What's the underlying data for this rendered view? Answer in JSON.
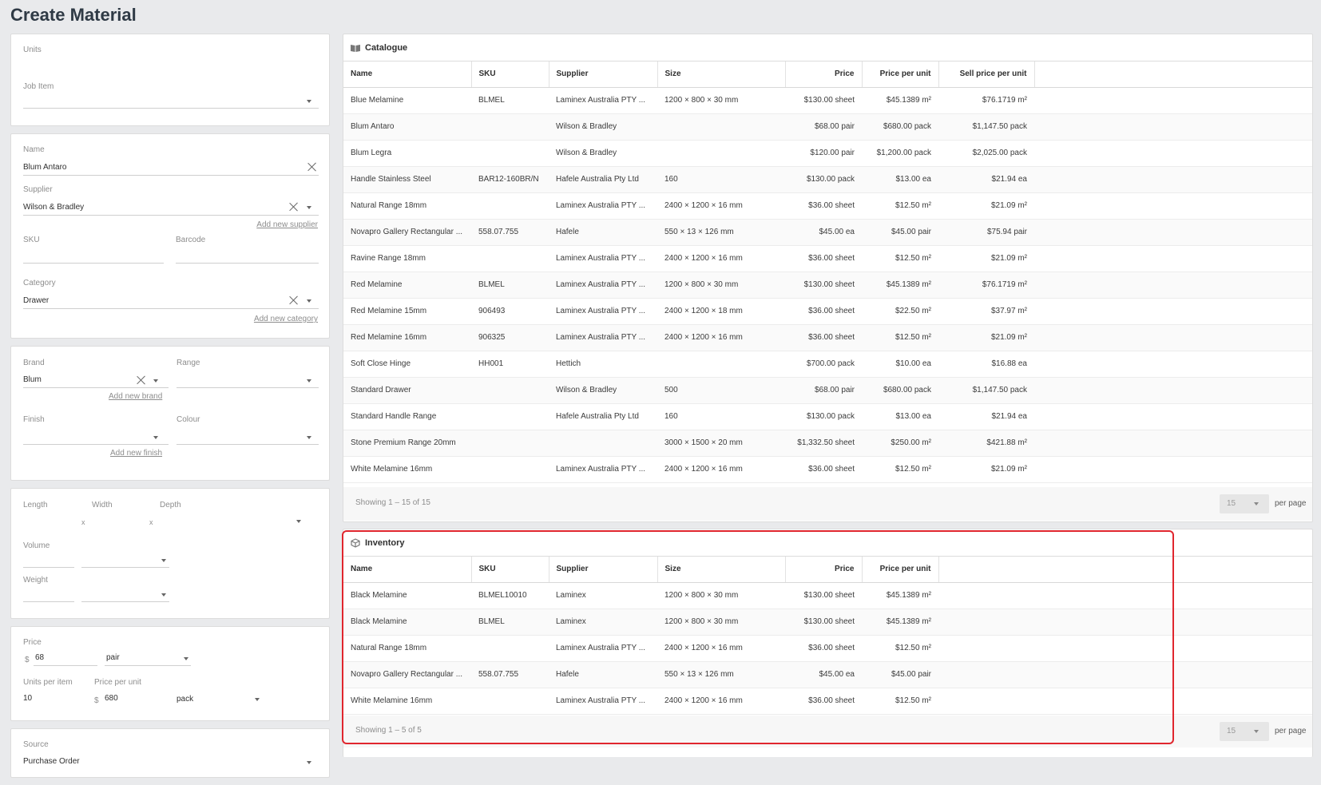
{
  "page": {
    "title": "Create Material"
  },
  "form": {
    "units_label": "Units",
    "job_item_label": "Job Item",
    "name_label": "Name",
    "name_value": "Blum Antaro",
    "supplier_label": "Supplier",
    "supplier_value": "Wilson & Bradley",
    "add_supplier": "Add new supplier",
    "sku_label": "SKU",
    "barcode_label": "Barcode",
    "category_label": "Category",
    "category_value": "Drawer",
    "add_category": "Add new category",
    "brand_label": "Brand",
    "brand_value": "Blum",
    "add_brand": "Add new brand",
    "range_label": "Range",
    "finish_label": "Finish",
    "add_finish": "Add new finish",
    "colour_label": "Colour",
    "length_label": "Length",
    "width_label": "Width",
    "depth_label": "Depth",
    "dim_sep": "x",
    "volume_label": "Volume",
    "weight_label": "Weight",
    "price_label": "Price",
    "currency": "$",
    "price_value": "68",
    "price_unit": "pair",
    "units_per_item_label": "Units per item",
    "units_per_item_value": "10",
    "price_per_unit_label": "Price per unit",
    "price_per_unit_value": "680",
    "price_per_unit_unit": "pack",
    "source_label": "Source",
    "source_value": "Purchase Order"
  },
  "catalogue": {
    "title": "Catalogue",
    "icon": "book-icon",
    "columns": [
      "Name",
      "SKU",
      "Supplier",
      "Size",
      "Price",
      "Price per unit",
      "Sell price per unit"
    ],
    "rows": [
      [
        "Blue Melamine",
        "BLMEL",
        "Laminex Australia PTY ...",
        "1200 × 800 × 30 mm",
        "$130.00 sheet",
        "$45.1389 m²",
        "$76.1719 m²"
      ],
      [
        "Blum Antaro",
        "",
        "Wilson & Bradley",
        "",
        "$68.00 pair",
        "$680.00 pack",
        "$1,147.50 pack"
      ],
      [
        "Blum Legra",
        "",
        "Wilson & Bradley",
        "",
        "$120.00 pair",
        "$1,200.00 pack",
        "$2,025.00 pack"
      ],
      [
        "Handle Stainless Steel",
        "BAR12-160BR/N",
        "Hafele Australia Pty Ltd",
        "160",
        "$130.00 pack",
        "$13.00 ea",
        "$21.94 ea"
      ],
      [
        "Natural Range 18mm",
        "",
        "Laminex Australia PTY ...",
        "2400 × 1200 × 16 mm",
        "$36.00 sheet",
        "$12.50 m²",
        "$21.09 m²"
      ],
      [
        "Novapro Gallery Rectangular ...",
        "558.07.755",
        "Hafele",
        "550 × 13 × 126 mm",
        "$45.00 ea",
        "$45.00 pair",
        "$75.94 pair"
      ],
      [
        "Ravine Range 18mm",
        "",
        "Laminex Australia PTY ...",
        "2400 × 1200 × 16 mm",
        "$36.00 sheet",
        "$12.50 m²",
        "$21.09 m²"
      ],
      [
        "Red Melamine",
        "BLMEL",
        "Laminex Australia PTY ...",
        "1200 × 800 × 30 mm",
        "$130.00 sheet",
        "$45.1389 m²",
        "$76.1719 m²"
      ],
      [
        "Red Melamine 15mm",
        "906493",
        "Laminex Australia PTY ...",
        "2400 × 1200 × 18 mm",
        "$36.00 sheet",
        "$22.50 m²",
        "$37.97 m²"
      ],
      [
        "Red Melamine 16mm",
        "906325",
        "Laminex Australia PTY ...",
        "2400 × 1200 × 16 mm",
        "$36.00 sheet",
        "$12.50 m²",
        "$21.09 m²"
      ],
      [
        "Soft Close Hinge",
        "HH001",
        "Hettich",
        "",
        "$700.00 pack",
        "$10.00 ea",
        "$16.88 ea"
      ],
      [
        "Standard Drawer",
        "",
        "Wilson & Bradley",
        "500",
        "$68.00 pair",
        "$680.00 pack",
        "$1,147.50 pack"
      ],
      [
        "Standard Handle Range",
        "",
        "Hafele Australia Pty Ltd",
        "160",
        "$130.00 pack",
        "$13.00 ea",
        "$21.94 ea"
      ],
      [
        "Stone Premium Range 20mm",
        "",
        "",
        "3000 × 1500 × 20 mm",
        "$1,332.50 sheet",
        "$250.00 m²",
        "$421.88 m²"
      ],
      [
        "White Melamine 16mm",
        "",
        "Laminex Australia PTY ...",
        "2400 × 1200 × 16 mm",
        "$36.00 sheet",
        "$12.50 m²",
        "$21.09 m²"
      ]
    ],
    "showing": "Showing 1 – 15 of 15",
    "per_page_value": "15",
    "per_page_label": "per page"
  },
  "inventory": {
    "title": "Inventory",
    "icon": "box-icon",
    "columns": [
      "Name",
      "SKU",
      "Supplier",
      "Size",
      "Price",
      "Price per unit"
    ],
    "rows": [
      [
        "Black Melamine",
        "BLMEL10010",
        "Laminex",
        "1200 × 800 × 30 mm",
        "$130.00 sheet",
        "$45.1389 m²"
      ],
      [
        "Black Melamine",
        "BLMEL",
        "Laminex",
        "1200 × 800 × 30 mm",
        "$130.00 sheet",
        "$45.1389 m²"
      ],
      [
        "Natural Range 18mm",
        "",
        "Laminex Australia PTY ...",
        "2400 × 1200 × 16 mm",
        "$36.00 sheet",
        "$12.50 m²"
      ],
      [
        "Novapro Gallery Rectangular ...",
        "558.07.755",
        "Hafele",
        "550 × 13 × 126 mm",
        "$45.00 ea",
        "$45.00 pair"
      ],
      [
        "White Melamine 16mm",
        "",
        "Laminex Australia PTY ...",
        "2400 × 1200 × 16 mm",
        "$36.00 sheet",
        "$12.50 m²"
      ]
    ],
    "showing": "Showing 1 – 5 of 5",
    "per_page_value": "15",
    "per_page_label": "per page"
  },
  "colors": {
    "highlight": "#e0262e",
    "background": "#e9eaec"
  }
}
